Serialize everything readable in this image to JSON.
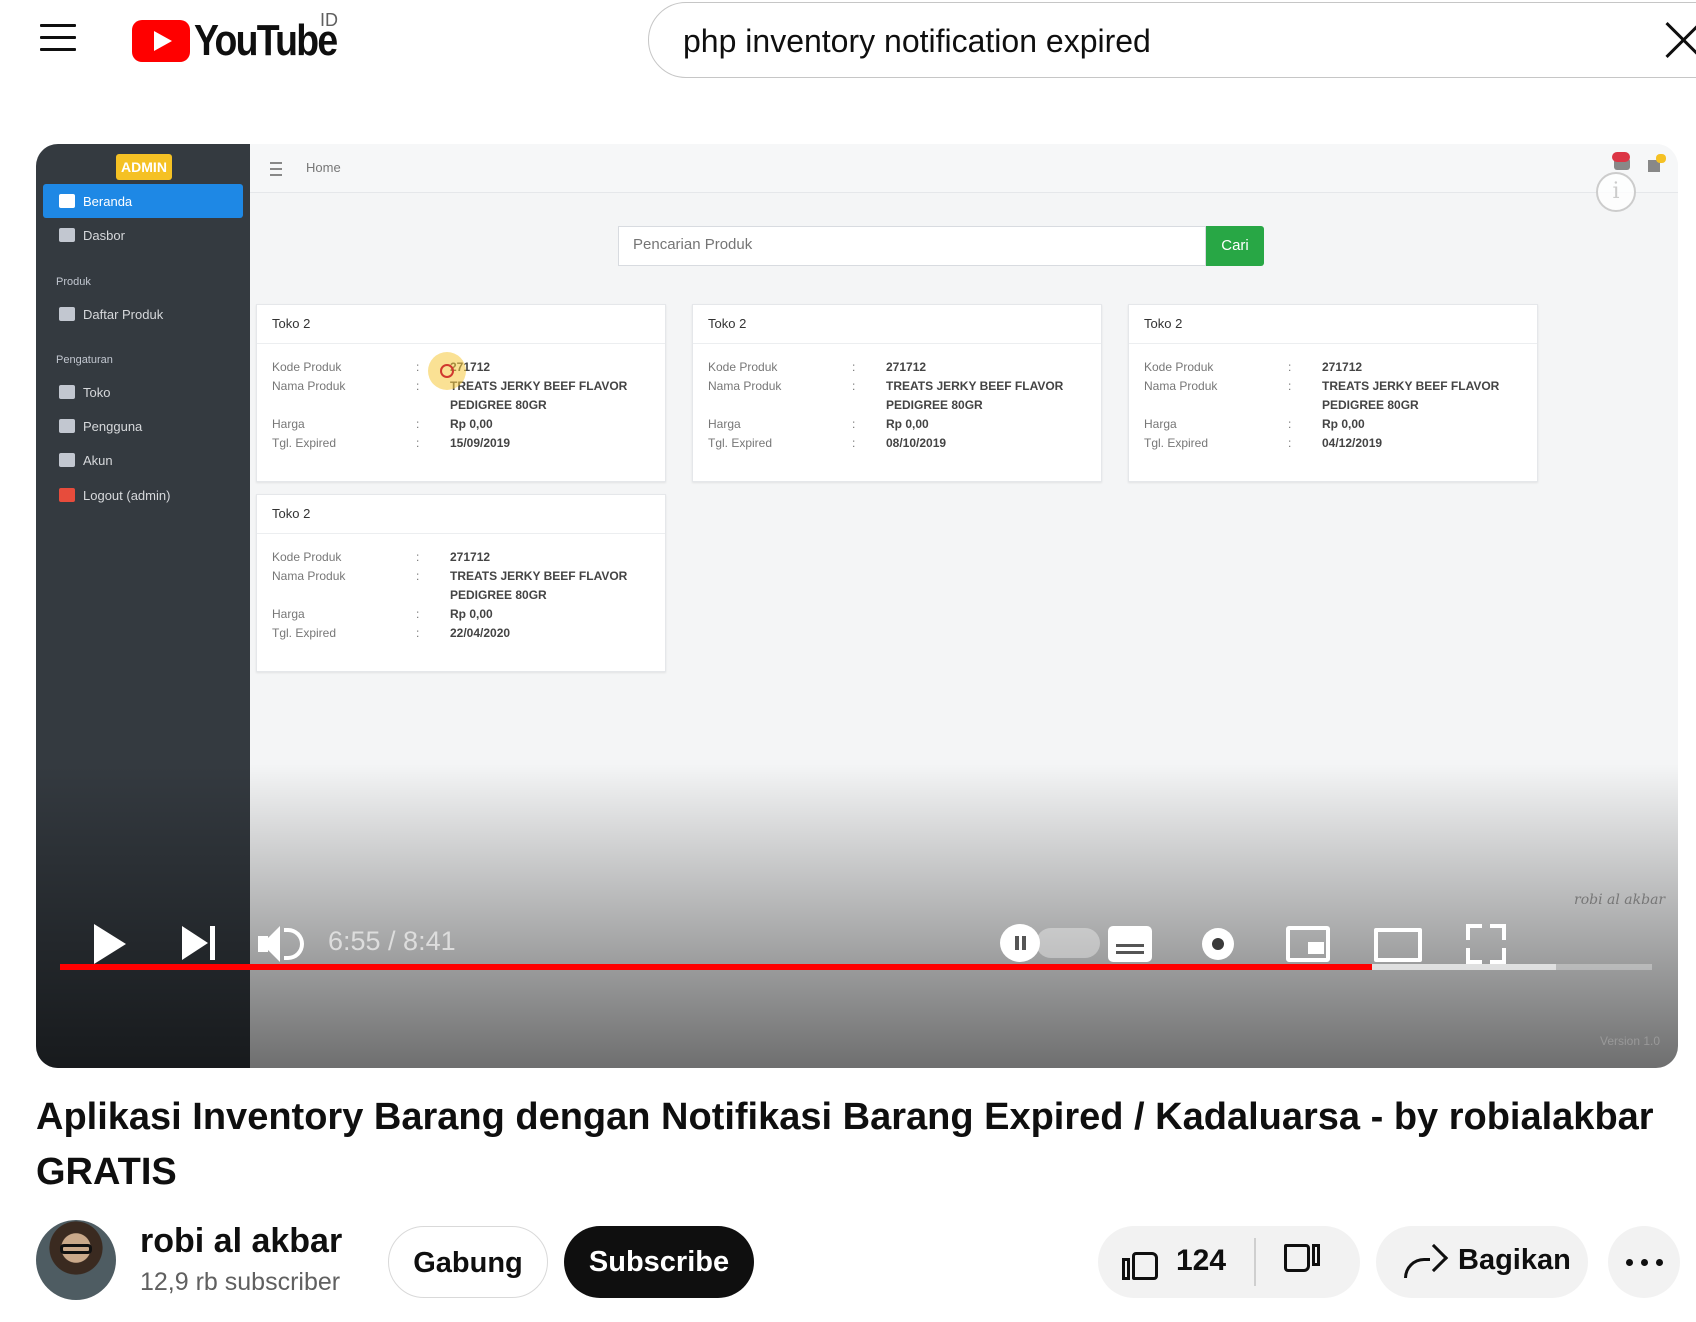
{
  "masthead": {
    "logo_text": "YouTube",
    "country_code": "ID",
    "search_query": "php inventory notification expired"
  },
  "video_frame": {
    "app": {
      "admin_badge": "ADMIN",
      "nav": [
        {
          "label": "Beranda",
          "active": true
        },
        {
          "label": "Dasbor"
        }
      ],
      "section_produk": "Produk",
      "nav_produk": [
        {
          "label": "Daftar Produk"
        }
      ],
      "section_pengaturan": "Pengaturan",
      "nav_pengaturan": [
        {
          "label": "Toko"
        },
        {
          "label": "Pengguna"
        },
        {
          "label": "Akun"
        },
        {
          "label": "Logout (admin)"
        }
      ],
      "breadcrumb": "Home",
      "search_placeholder": "Pencarian Produk",
      "search_button": "Cari",
      "labels": {
        "kode": "Kode Produk",
        "nama": "Nama Produk",
        "harga": "Harga",
        "expired": "Tgl. Expired",
        "colon": ":"
      },
      "cards": [
        {
          "store": "Toko 2",
          "kode": "271712",
          "nama1": "TREATS JERKY BEEF FLAVOR",
          "nama2": "PEDIGREE 80GR",
          "harga": "Rp 0,00",
          "expired": "15/09/2019"
        },
        {
          "store": "Toko 2",
          "kode": "271712",
          "nama1": "TREATS JERKY BEEF FLAVOR",
          "nama2": "PEDIGREE 80GR",
          "harga": "Rp 0,00",
          "expired": "08/10/2019"
        },
        {
          "store": "Toko 2",
          "kode": "271712",
          "nama1": "TREATS JERKY BEEF FLAVOR",
          "nama2": "PEDIGREE 80GR",
          "harga": "Rp 0,00",
          "expired": "04/12/2019"
        },
        {
          "store": "Toko 2",
          "kode": "271712",
          "nama1": "TREATS JERKY BEEF FLAVOR",
          "nama2": "PEDIGREE 80GR",
          "harga": "Rp 0,00",
          "expired": "22/04/2020"
        }
      ],
      "watermark": "robi al akbar",
      "version": "Version 1.0"
    }
  },
  "player": {
    "time_display": "6:55 / 8:41",
    "progress_played_fraction": 0.824,
    "progress_buffered_fraction": 0.94,
    "colors": {
      "progress": "#ff0000"
    }
  },
  "video": {
    "title": "Aplikasi Inventory Barang dengan Notifikasi Barang Expired / Kadaluarsa - by robialakbar GRATIS"
  },
  "channel": {
    "name": "robi al akbar",
    "subscribers": "12,9 rb subscriber",
    "join_label": "Gabung",
    "subscribe_label": "Subscribe"
  },
  "actions": {
    "like_count": "124",
    "share_label": "Bagikan"
  }
}
